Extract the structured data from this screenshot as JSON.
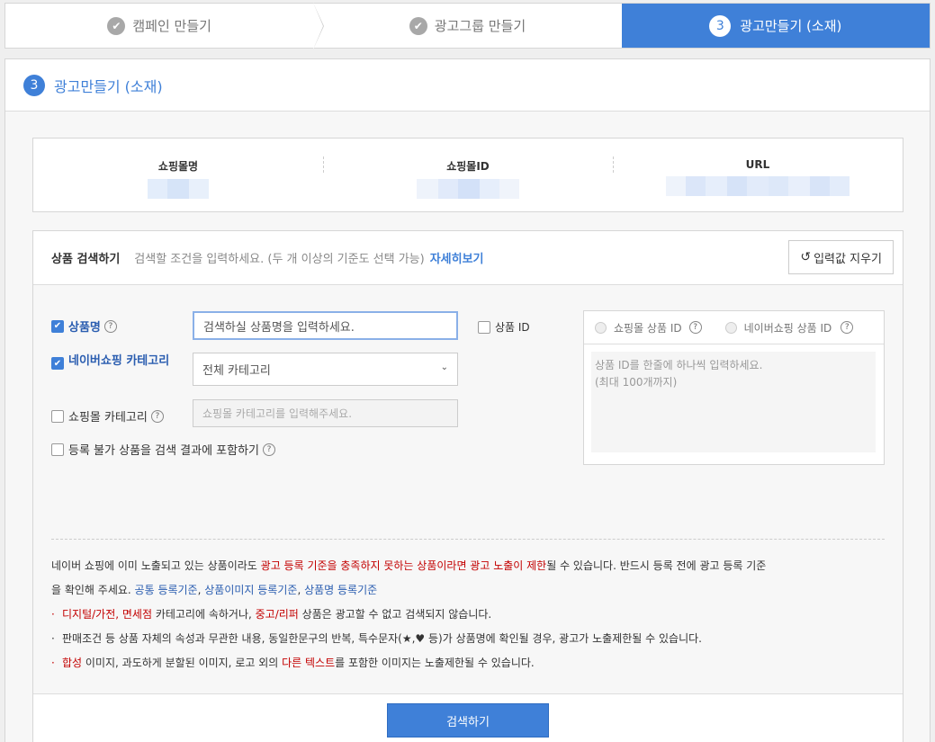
{
  "stepper": {
    "step1": "캠페인 만들기",
    "step2": "광고그룹 만들기",
    "step3_num": "3",
    "step3": "광고만들기 (소재)"
  },
  "panel": {
    "num": "3",
    "title": "광고만들기 (소재)"
  },
  "info": {
    "mall_name_label": "쇼핑몰명",
    "mall_id_label": "쇼핑몰ID",
    "url_label": "URL"
  },
  "search": {
    "title": "상품 검색하기",
    "desc": "검색할 조건을 입력하세요. (두 개 이상의 기준도 선택 가능)",
    "link": "자세히보기",
    "reset": "입력값 지우기",
    "product_name_label": "상품명",
    "product_name_placeholder": "검색하실 상품명을 입력하세요.",
    "product_id_label": "상품 ID",
    "naver_category_label": "네이버쇼핑 카테고리",
    "naver_category_value": "전체 카테고리",
    "mall_category_label": "쇼핑몰 카테고리",
    "mall_category_placeholder": "쇼핑몰 카테고리를 입력해주세요.",
    "include_unregistrable": "등록 불가 상품을 검색 결과에 포함하기",
    "radio_mall_id": "쇼핑몰 상품 ID",
    "radio_naver_id": "네이버쇼핑 상품 ID",
    "id_area_line1": "상품 ID를 한줄에 하나씩 입력하세요.",
    "id_area_line2": "(최대 100개까지)",
    "search_button": "검색하기"
  },
  "notice": {
    "p1_a": "네이버 쇼핑에 이미 노출되고 있는 상품이라도 ",
    "p1_red": "광고 등록 기준을 충족하지 못하는 상품이라면 광고 노출이 제한",
    "p1_b": "될 수 있습니다. 반드시 등록 전에 광고 등록 기준",
    "p2_a": "을 확인해 주세요. ",
    "link1": "공통 등록기준",
    "comma1": ", ",
    "link2": "상품이미지 등록기준",
    "comma2": ", ",
    "link3": "상품명 등록기준",
    "b1_red1": "디지털/가전, 면세점",
    "b1_a": " 카테고리에 속하거나, ",
    "b1_red2": "중고/리퍼",
    "b1_b": " 상품은 광고할 수 없고 검색되지 않습니다.",
    "b2": "판매조건 등 상품 자체의 속성과 무관한 내용, 동일한문구의 반복, 특수문자(★,♥ 등)가 상품명에 확인될 경우, 광고가 노출제한될 수 있습니다.",
    "b3_red1": "합성",
    "b3_a": " 이미지, 과도하게 분할된 이미지, 로고 외의 ",
    "b3_red2": "다른 텍스트",
    "b3_b": "를 포함한 이미지는 노출제한될 수 있습니다."
  }
}
